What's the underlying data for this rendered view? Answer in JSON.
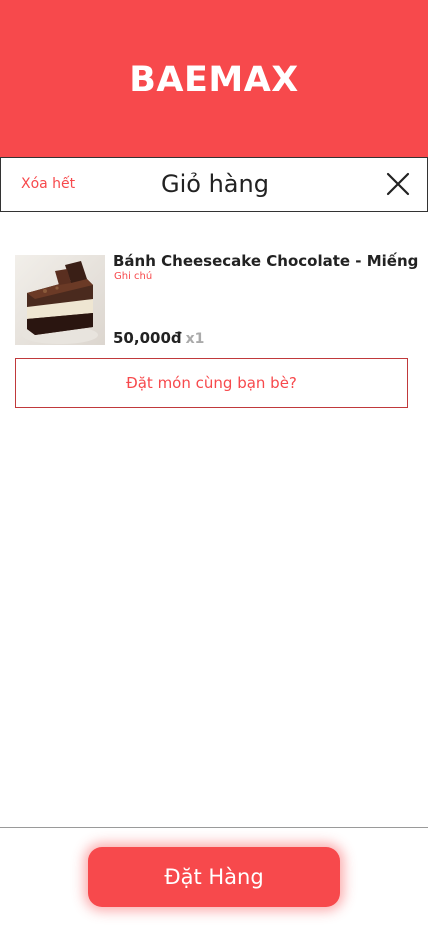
{
  "app": {
    "brand": "BAEMAX",
    "accent_color": "#f7494c"
  },
  "titlebar": {
    "clear_all_label": "Xóa hết",
    "title": "Giỏ hàng",
    "close_icon": "close-icon"
  },
  "cart": {
    "items": [
      {
        "name": "Bánh Cheesecake Chocolate - Miếng",
        "note": "Ghi chú",
        "price": "50,000đ",
        "quantity": "x1",
        "image": "chocolate-cheesecake-slice"
      }
    ]
  },
  "group_order_label": "Đặt món cùng bạn bè?",
  "checkout_label": "Đặt Hàng"
}
